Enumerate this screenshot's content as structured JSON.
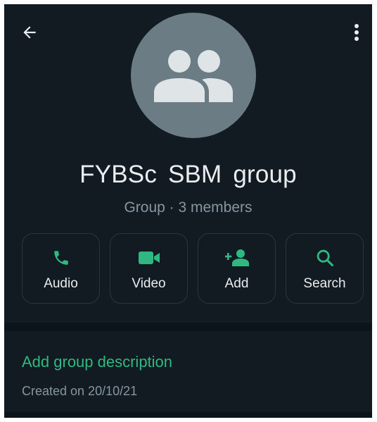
{
  "header": {
    "back_icon": "arrow-left-icon",
    "menu_icon": "more-vertical-icon"
  },
  "profile": {
    "avatar_icon": "group-icon",
    "name": "FYBSc SBM group",
    "subtitle": "Group · 3 members"
  },
  "actions": [
    {
      "label": "Audio",
      "icon": "phone-icon"
    },
    {
      "label": "Video",
      "icon": "video-camera-icon"
    },
    {
      "label": "Add",
      "icon": "add-person-icon"
    },
    {
      "label": "Search",
      "icon": "search-icon"
    }
  ],
  "description": {
    "add_label": "Add group description",
    "created": "Created on 20/10/21"
  },
  "colors": {
    "background": "#121b22",
    "accent": "#2fb882",
    "text_primary": "#e9edef",
    "text_secondary": "#8696a0",
    "avatar_bg": "#6b7c85"
  }
}
